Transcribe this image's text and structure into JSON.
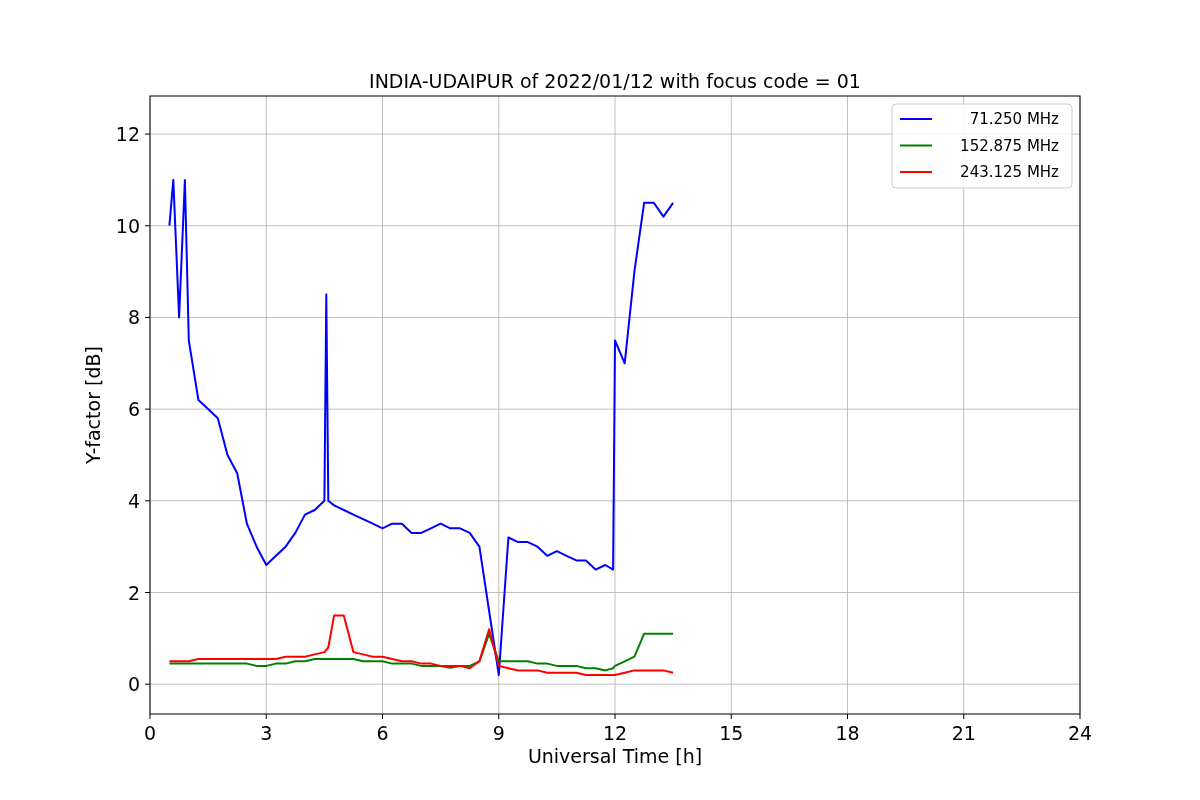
{
  "chart_data": {
    "type": "line",
    "title": "INDIA-UDAIPUR of 2022/01/12 with focus code = 01",
    "xlabel": "Universal Time [h]",
    "ylabel": "Y-factor [dB]",
    "x": [
      0.5,
      0.6,
      0.75,
      0.9,
      1.0,
      1.25,
      1.5,
      1.75,
      2.0,
      2.25,
      2.5,
      2.75,
      3.0,
      3.25,
      3.5,
      3.75,
      4.0,
      4.25,
      4.5,
      4.55,
      4.6,
      4.75,
      5.0,
      5.25,
      5.5,
      5.75,
      6.0,
      6.25,
      6.5,
      6.75,
      7.0,
      7.25,
      7.5,
      7.75,
      8.0,
      8.25,
      8.5,
      8.75,
      9.0,
      9.25,
      9.5,
      9.75,
      10.0,
      10.25,
      10.5,
      10.75,
      11.0,
      11.25,
      11.5,
      11.75,
      11.95,
      12.0,
      12.25,
      12.5,
      12.75,
      13.0,
      13.25,
      13.5
    ],
    "series": [
      {
        "name": "71.250 MHz",
        "color": "#0000ff",
        "values": [
          10.0,
          11.0,
          8.0,
          11.0,
          7.5,
          6.2,
          6.0,
          5.8,
          5.0,
          4.6,
          3.5,
          3.0,
          2.6,
          2.8,
          3.0,
          3.3,
          3.7,
          3.8,
          4.0,
          8.5,
          4.0,
          3.9,
          3.8,
          3.7,
          3.6,
          3.5,
          3.4,
          3.5,
          3.5,
          3.3,
          3.3,
          3.4,
          3.5,
          3.4,
          3.4,
          3.3,
          3.0,
          1.6,
          0.2,
          3.2,
          3.1,
          3.1,
          3.0,
          2.8,
          2.9,
          2.8,
          2.7,
          2.7,
          2.5,
          2.6,
          2.5,
          7.5,
          7.0,
          9.0,
          10.5,
          10.5,
          10.2,
          10.5
        ]
      },
      {
        "name": "152.875 MHz",
        "color": "#008000",
        "values": [
          0.45,
          0.45,
          0.45,
          0.45,
          0.45,
          0.45,
          0.45,
          0.45,
          0.45,
          0.45,
          0.45,
          0.4,
          0.4,
          0.45,
          0.45,
          0.5,
          0.5,
          0.55,
          0.55,
          0.55,
          0.55,
          0.55,
          0.55,
          0.55,
          0.5,
          0.5,
          0.5,
          0.45,
          0.45,
          0.45,
          0.4,
          0.4,
          0.4,
          0.36,
          0.4,
          0.4,
          0.5,
          1.1,
          0.5,
          0.5,
          0.5,
          0.5,
          0.45,
          0.45,
          0.4,
          0.4,
          0.4,
          0.35,
          0.35,
          0.3,
          0.35,
          0.4,
          0.5,
          0.6,
          1.1,
          1.1,
          1.1,
          1.1
        ]
      },
      {
        "name": "243.125 MHz",
        "color": "#ff0000",
        "values": [
          0.5,
          0.5,
          0.5,
          0.5,
          0.5,
          0.55,
          0.55,
          0.55,
          0.55,
          0.55,
          0.55,
          0.55,
          0.55,
          0.55,
          0.6,
          0.6,
          0.6,
          0.65,
          0.7,
          0.75,
          0.8,
          1.5,
          1.5,
          0.7,
          0.65,
          0.6,
          0.6,
          0.55,
          0.5,
          0.5,
          0.45,
          0.45,
          0.4,
          0.4,
          0.4,
          0.35,
          0.5,
          1.2,
          0.4,
          0.35,
          0.3,
          0.3,
          0.3,
          0.25,
          0.25,
          0.25,
          0.25,
          0.2,
          0.2,
          0.2,
          0.2,
          0.2,
          0.25,
          0.3,
          0.3,
          0.3,
          0.3,
          0.25
        ]
      }
    ],
    "grid": true,
    "legend": true,
    "xlim": [
      0,
      24
    ],
    "ylim": [
      -0.65,
      12.83
    ],
    "xticks": [
      0,
      3,
      6,
      9,
      12,
      15,
      18,
      21,
      24
    ],
    "yticks": [
      0,
      2,
      4,
      6,
      8,
      10,
      12
    ]
  }
}
